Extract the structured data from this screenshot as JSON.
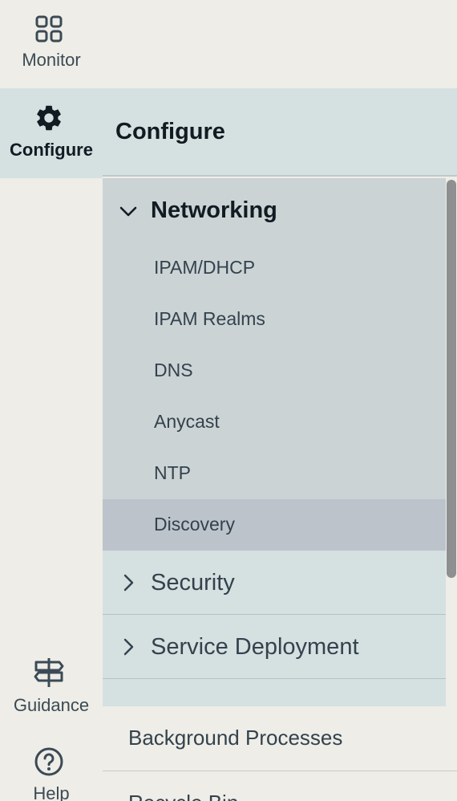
{
  "rail": {
    "items": [
      {
        "label": "Monitor",
        "icon": "grid-icon"
      },
      {
        "label": "Configure",
        "icon": "gear-icon"
      },
      {
        "label": "Guidance",
        "icon": "signpost-icon"
      },
      {
        "label": "Help",
        "icon": "help-circle-icon"
      }
    ]
  },
  "panel": {
    "title": "Configure",
    "groups": [
      {
        "label": "Networking",
        "expanded": true,
        "items": [
          "IPAM/DHCP",
          "IPAM Realms",
          "DNS",
          "Anycast",
          "NTP",
          "Discovery"
        ],
        "selected": "Discovery"
      },
      {
        "label": "Security",
        "expanded": false
      },
      {
        "label": "Service Deployment",
        "expanded": false
      }
    ],
    "bottom_items": [
      "Background Processes",
      "Recycle Bin"
    ]
  },
  "colors": {
    "rail_bg": "#eeede7",
    "active_bg": "#d5e0e1",
    "expanded_group_bg": "#cbd3d5",
    "selected_item_bg": "#bcc3cb"
  }
}
